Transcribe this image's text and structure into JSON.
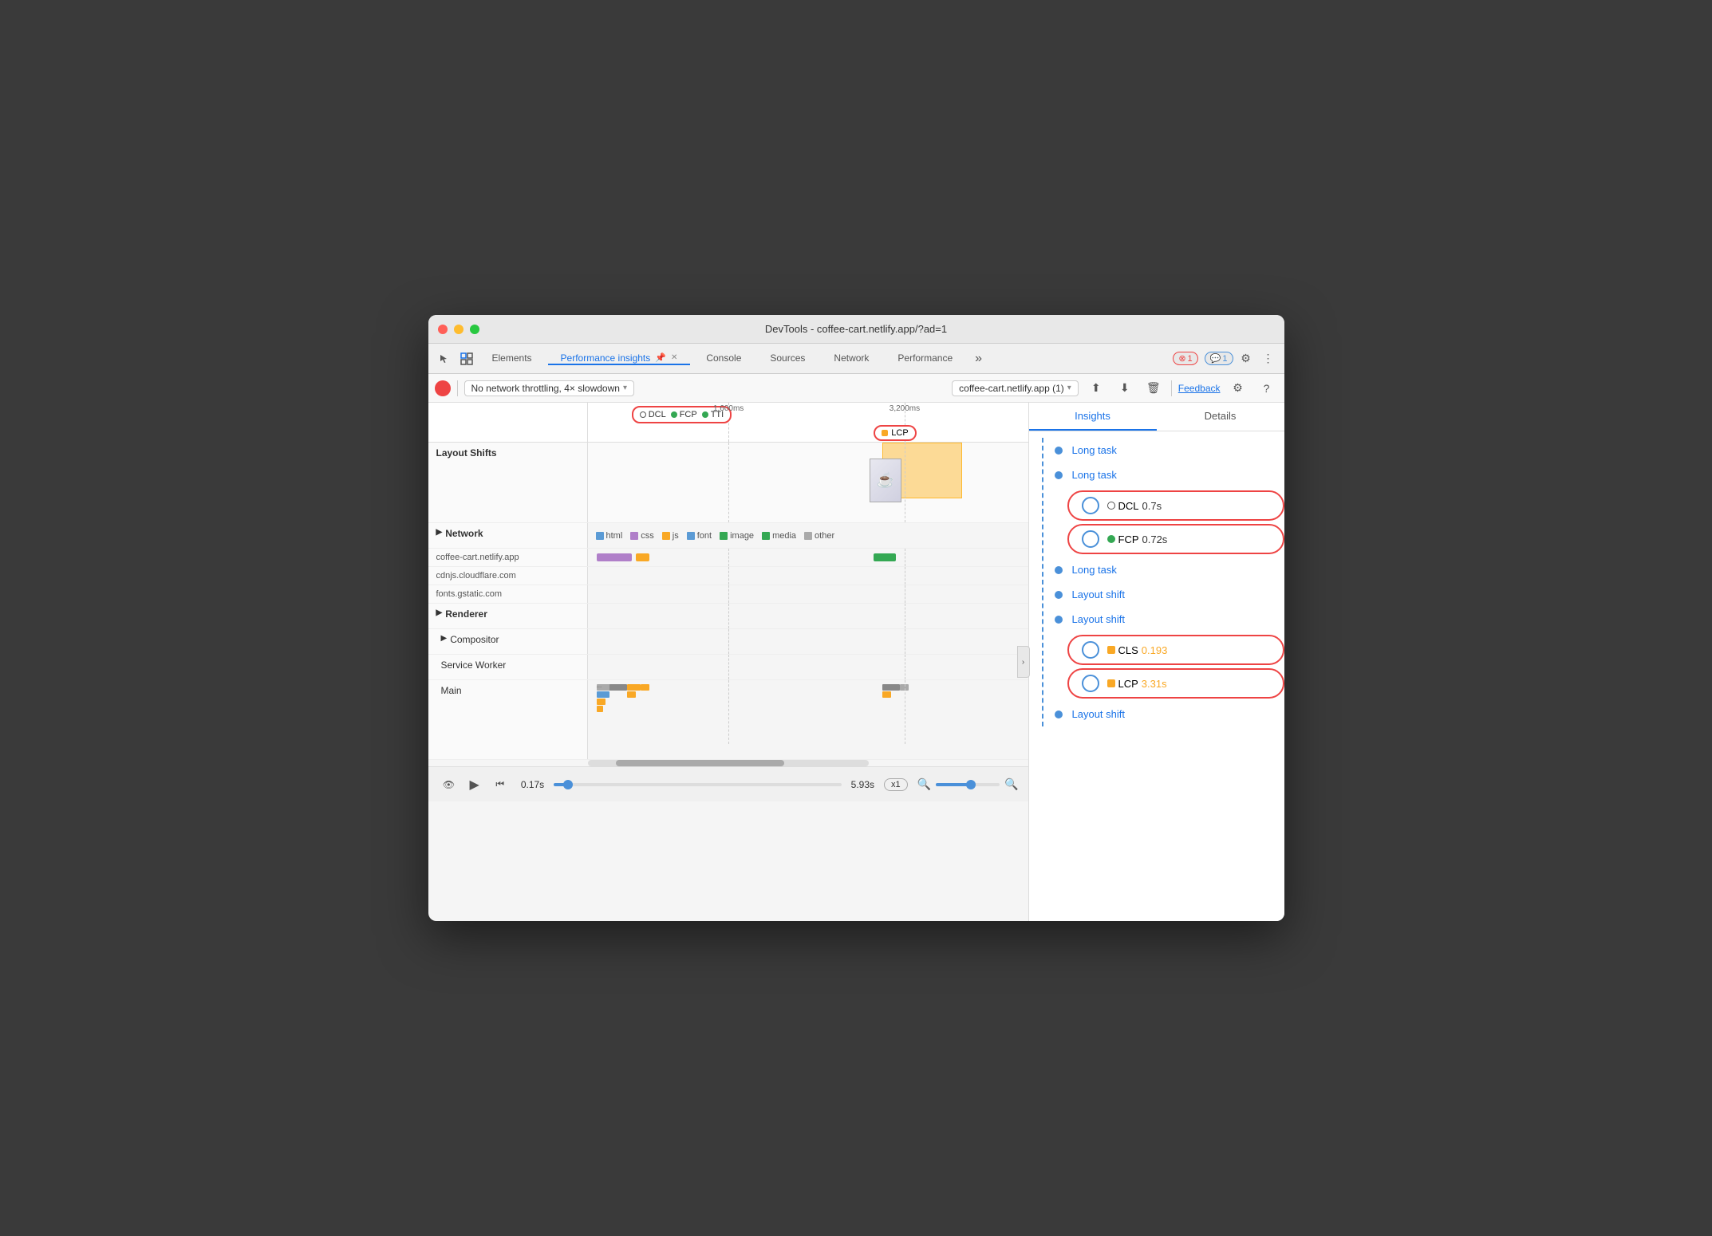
{
  "window": {
    "title": "DevTools - coffee-cart.netlify.app/?ad=1"
  },
  "tabs": [
    {
      "id": "elements",
      "label": "Elements",
      "active": false
    },
    {
      "id": "performance-insights",
      "label": "Performance insights",
      "active": true,
      "closable": true
    },
    {
      "id": "console",
      "label": "Console",
      "active": false
    },
    {
      "id": "sources",
      "label": "Sources",
      "active": false
    },
    {
      "id": "network",
      "label": "Network",
      "active": false
    },
    {
      "id": "performance",
      "label": "Performance",
      "active": false
    }
  ],
  "notifications": {
    "error_count": "1",
    "info_count": "1"
  },
  "controls": {
    "throttle_label": "No network throttling, 4× slowdown",
    "url_label": "coffee-cart.netlify.app (1)",
    "feedback_label": "Feedback"
  },
  "timeline": {
    "marker1_time": "1,600ms",
    "marker2_time": "3,200ms",
    "dcl_label": "DCL",
    "fcp_label": "FCP",
    "tti_label": "TTI",
    "lcp_label": "LCP"
  },
  "sections": {
    "layout_shifts": "Layout Shifts",
    "network": "Network",
    "renderer": "Renderer",
    "compositor": "Compositor",
    "service_worker": "Service Worker",
    "main": "Main"
  },
  "network_legend": [
    {
      "id": "html",
      "label": "html",
      "color": "#5b9bd5"
    },
    {
      "id": "css",
      "label": "css",
      "color": "#b07fc9"
    },
    {
      "id": "js",
      "label": "js",
      "color": "#f9a825"
    },
    {
      "id": "font",
      "label": "font",
      "color": "#5b9bd5"
    },
    {
      "id": "image",
      "label": "image",
      "color": "#34a853"
    },
    {
      "id": "media",
      "label": "media",
      "color": "#34a853"
    },
    {
      "id": "other",
      "label": "other",
      "color": "#aaa"
    }
  ],
  "network_resources": [
    {
      "id": "coffee-cart",
      "label": "coffee-cart.netlify.app"
    },
    {
      "id": "cloudflare",
      "label": "cdnjs.cloudflare.com"
    },
    {
      "id": "gstatic",
      "label": "fonts.gstatic.com"
    }
  ],
  "insights_tabs": [
    {
      "id": "insights",
      "label": "Insights",
      "active": true
    },
    {
      "id": "details",
      "label": "Details",
      "active": false
    }
  ],
  "insights_items": [
    {
      "id": "long-task-1",
      "label": "Long task",
      "type": "link"
    },
    {
      "id": "long-task-2",
      "label": "Long task",
      "type": "link"
    },
    {
      "id": "dcl-card",
      "label": "DCL",
      "value": "0.7s",
      "type": "metric",
      "icon": "dcl"
    },
    {
      "id": "fcp-card",
      "label": "FCP",
      "value": "0.72s",
      "type": "metric",
      "icon": "fcp"
    },
    {
      "id": "long-task-3",
      "label": "Long task",
      "type": "link"
    },
    {
      "id": "layout-shift-1",
      "label": "Layout shift",
      "type": "link"
    },
    {
      "id": "layout-shift-2",
      "label": "Layout shift",
      "type": "link"
    },
    {
      "id": "cls-card",
      "label": "CLS",
      "value": "0.193",
      "type": "metric",
      "icon": "cls"
    },
    {
      "id": "lcp-card",
      "label": "LCP",
      "value": "3.31s",
      "type": "metric",
      "icon": "lcp"
    },
    {
      "id": "layout-shift-3",
      "label": "Layout shift",
      "type": "link"
    }
  ],
  "playback": {
    "start_time": "0.17s",
    "end_time": "5.93s",
    "speed": "x1",
    "slider_percent": 5
  }
}
